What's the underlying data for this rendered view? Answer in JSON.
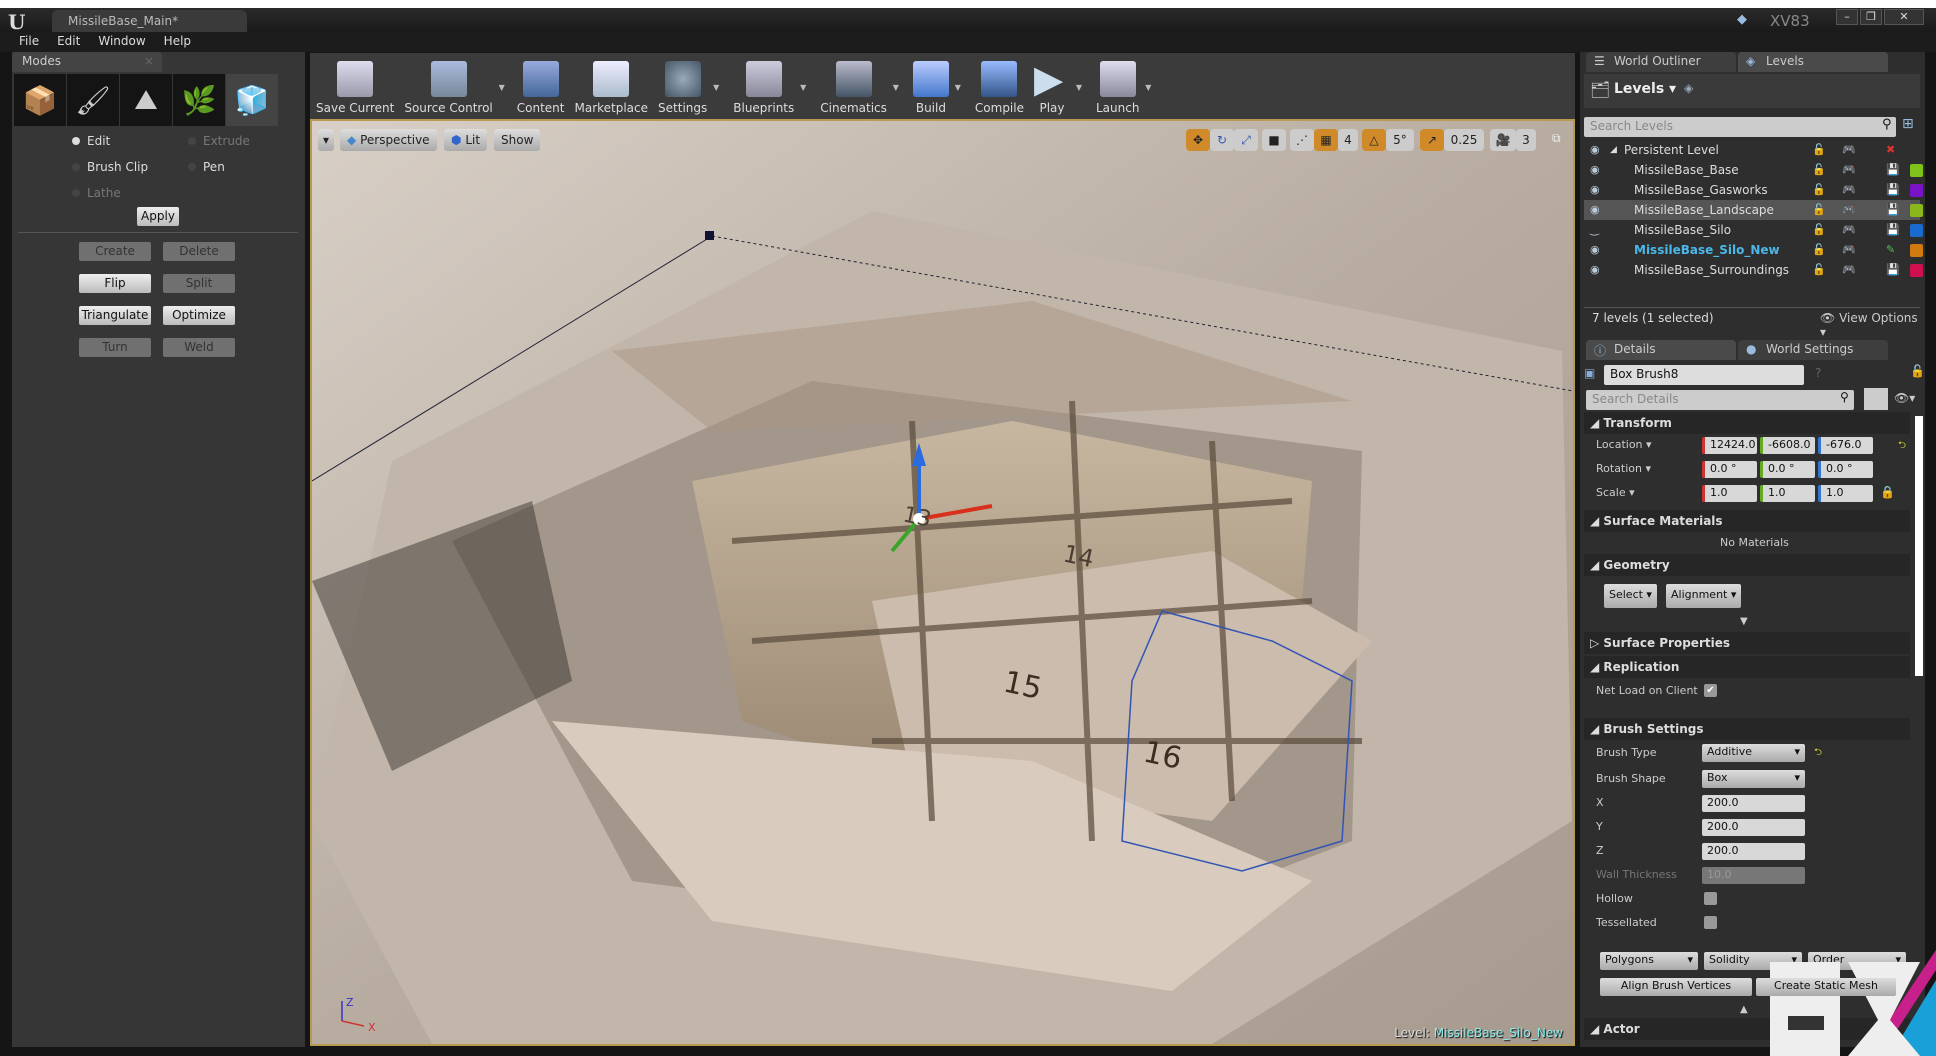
{
  "window": {
    "logo": "U",
    "doc_tab": "MissileBase_Main*",
    "user": "XV83",
    "controls": [
      "–",
      "❐",
      "✕"
    ]
  },
  "menu": [
    "File",
    "Edit",
    "Window",
    "Help"
  ],
  "modes": {
    "tab": "Modes",
    "tools": [
      "place-icon",
      "paint-icon",
      "landscape-icon",
      "foliage-icon",
      "geometry-icon"
    ],
    "radios": [
      {
        "label": "Edit",
        "state": "on"
      },
      {
        "label": "Extrude",
        "state": "disabled"
      },
      {
        "label": "Brush Clip",
        "state": "off"
      },
      {
        "label": "Pen",
        "state": "off"
      },
      {
        "label": "Lathe",
        "state": "disabled"
      }
    ],
    "apply": "Apply",
    "buttons": [
      {
        "label": "Create",
        "enabled": false
      },
      {
        "label": "Delete",
        "enabled": false
      },
      {
        "label": "Flip",
        "enabled": true
      },
      {
        "label": "Split",
        "enabled": false
      },
      {
        "label": "Triangulate",
        "enabled": true
      },
      {
        "label": "Optimize",
        "enabled": true
      },
      {
        "label": "Turn",
        "enabled": false
      },
      {
        "label": "Weld",
        "enabled": false
      }
    ]
  },
  "toolbar": [
    "Save Current",
    "Source Control",
    "Content",
    "Marketplace",
    "Settings",
    "Blueprints",
    "Cinematics",
    "Build",
    "Compile",
    "Play",
    "Launch"
  ],
  "viewport": {
    "perspective": "Perspective",
    "lit": "Lit",
    "show": "Show",
    "grid_snap": "4",
    "rot_snap": "5°",
    "scale_snap": "0.25",
    "camera_speed": "3",
    "level_label": "Level:",
    "level_name": "MissileBase_Silo_New",
    "room_numbers": [
      "13",
      "14",
      "15",
      "16"
    ],
    "axis": [
      "Z",
      "X"
    ]
  },
  "levels_panel": {
    "tabs": [
      "World Outliner",
      "Levels"
    ],
    "header": "Levels",
    "search_placeholder": "Search Levels",
    "rows": [
      {
        "name": "Persistent Level",
        "color": "",
        "visible": true
      },
      {
        "name": "MissileBase_Base",
        "color": "#7fc31a",
        "visible": true
      },
      {
        "name": "MissileBase_Gasworks",
        "color": "#7a12c8",
        "visible": true
      },
      {
        "name": "MissileBase_Landscape",
        "color": "#8ab81a",
        "visible": true,
        "selected": true
      },
      {
        "name": "MissileBase_Silo",
        "color": "#1b6ad0",
        "visible": false
      },
      {
        "name": "MissileBase_Silo_New",
        "color": "#d07a10",
        "visible": true,
        "current": true
      },
      {
        "name": "MissileBase_Surroundings",
        "color": "#d0104e",
        "visible": true
      }
    ],
    "footer": "7 levels (1 selected)",
    "view_options": "View Options"
  },
  "details": {
    "tabs": [
      "Details",
      "World Settings"
    ],
    "name": "Box Brush8",
    "search_placeholder": "Search Details",
    "transform": {
      "title": "Transform",
      "location_label": "Location",
      "location": [
        "12424.0",
        "-6608.0",
        "-676.0"
      ],
      "rotation_label": "Rotation",
      "rotation": [
        "0.0 °",
        "0.0 °",
        "0.0 °"
      ],
      "scale_label": "Scale",
      "scale": [
        "1.0",
        "1.0",
        "1.0"
      ]
    },
    "surface_materials": {
      "title": "Surface Materials",
      "empty": "No Materials"
    },
    "geometry": {
      "title": "Geometry",
      "select": "Select",
      "alignment": "Alignment"
    },
    "surface_properties": "Surface Properties",
    "replication": {
      "title": "Replication",
      "net_load_label": "Net Load on Client",
      "net_load": true
    },
    "brush": {
      "title": "Brush Settings",
      "type_label": "Brush Type",
      "type": "Additive",
      "shape_label": "Brush Shape",
      "shape": "Box",
      "x_label": "X",
      "x": "200.0",
      "y_label": "Y",
      "y": "200.0",
      "z_label": "Z",
      "z": "200.0",
      "wall_label": "Wall Thickness",
      "wall": "10.0",
      "hollow_label": "Hollow",
      "hollow": false,
      "tess_label": "Tessellated",
      "tess": false,
      "polygons": "Polygons",
      "solidity": "Solidity",
      "order": "Order",
      "align": "Align Brush Vertices",
      "create_mesh": "Create Static Mesh"
    },
    "actor": "Actor"
  },
  "colors": {
    "accent": "#d08a2a",
    "viewport_border": "#b89b50",
    "current_level": "#4ab8e8"
  }
}
